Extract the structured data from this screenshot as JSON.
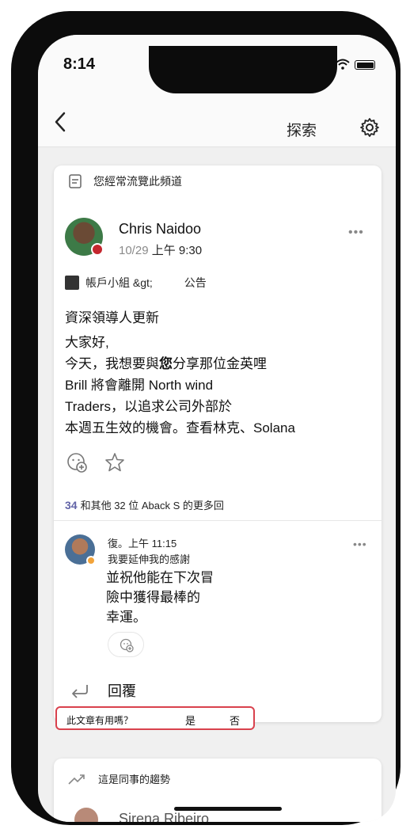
{
  "status": {
    "time": "8:14"
  },
  "nav": {
    "title": "探索"
  },
  "card": {
    "header_label": "您經常流覽此頻道",
    "post": {
      "author": "Chris Naidoo",
      "date": "10/29",
      "time": "上午 9:30",
      "team": "帳戶小組 &gt;",
      "channel": "公告",
      "subject": "資深領導人更新",
      "body_lines": [
        "大家好,",
        "今天，我想要與",
        "您",
        "分享那位金英哩",
        "Brill 將會離開 North wind",
        "Traders，以追求公司外部於",
        "本週五生效的機會。查看林克、Solana"
      ]
    },
    "replies": {
      "count": "34",
      "text": "和其他 32 位 Aback S 的更多回"
    },
    "reply": {
      "time": "復。上午 11:15",
      "line1": "我要延伸我的感謝",
      "body_lines": [
        "並祝他能在下次冒",
        "險中獲得最棒的",
        "幸運。"
      ]
    },
    "reply_button_label": "回覆"
  },
  "feedback": {
    "question": "此文章有用嗎？",
    "yes_label": "是",
    "no_label": "否"
  },
  "trending": {
    "header_label": "這是同事的趨勢",
    "person_name": "Sirena Ribeiro"
  },
  "colors": {
    "accent": "#6264a7",
    "presence_busy": "#c4262e",
    "presence_away": "#f2a33a",
    "highlight_border": "#d9414d"
  }
}
